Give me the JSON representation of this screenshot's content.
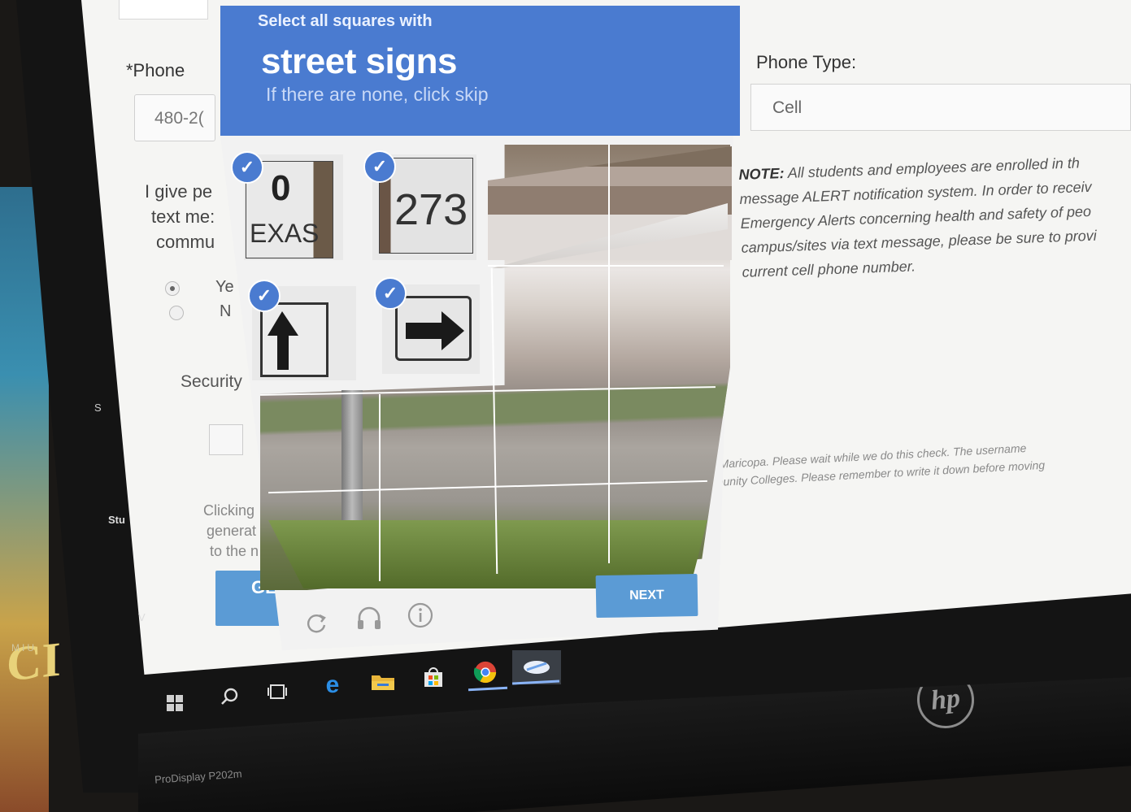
{
  "captcha": {
    "instruction_small": "Select all squares with",
    "instruction_target": "street signs",
    "instruction_hint": "If there are none, click skip",
    "next_label": "NEXT",
    "tile_texts": {
      "texas": "EXAS",
      "route": "273",
      "route_top": "0"
    },
    "check_glyph": "✓",
    "accent_color": "#4a7bd0",
    "icons": [
      "reload-icon",
      "audio-icon",
      "info-icon"
    ]
  },
  "form": {
    "phone_label": "*Phone",
    "phone_value": "480-2(",
    "consent_lines": [
      "I give pe",
      "text me:",
      "commu"
    ],
    "radio_yes": "Ye",
    "radio_no": "N",
    "security_label": "Security",
    "clicking_lines": [
      "Clicking",
      "generat",
      "to the n"
    ],
    "get_label": "GE",
    "phone_type_label": "Phone Type:",
    "phone_type_value": "Cell",
    "note_bold": "NOTE:",
    "note_lines": [
      " All students and employees are enrolled in th",
      "message ALERT notification system. In order to receiv",
      "Emergency Alerts concerning health and safety of peo",
      "campus/sites via text message, please be sure to provi",
      "current cell phone number."
    ],
    "maricopa_lines": [
      "Maricopa. Please wait while we do this check. The username",
      "nunity Colleges. Please remember to write it down before moving"
    ]
  },
  "desktop": {
    "side_labels": [
      "S",
      "Stu",
      "V"
    ],
    "poster_text": "CI",
    "poster_small": "MIU",
    "taskbar_icons": [
      "windows-start-icon",
      "search-icon",
      "task-view-icon",
      "edge-icon",
      "file-explorer-icon",
      "store-icon",
      "chrome-icon",
      "app-icon"
    ]
  },
  "monitor": {
    "model": "ProDisplay P202m",
    "logo": "hp"
  }
}
